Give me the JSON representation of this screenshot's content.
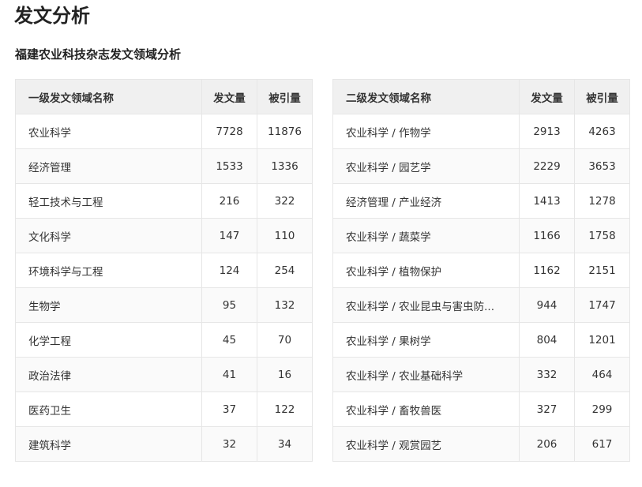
{
  "page_title": "发文分析",
  "section_title": "福建农业科技杂志发文领域分析",
  "primary_table": {
    "headers": {
      "name": "一级发文领域名称",
      "papers": "发文量",
      "citations": "被引量"
    },
    "rows": [
      {
        "name": "农业科学",
        "papers": "7728",
        "citations": "11876"
      },
      {
        "name": "经济管理",
        "papers": "1533",
        "citations": "1336"
      },
      {
        "name": "轻工技术与工程",
        "papers": "216",
        "citations": "322"
      },
      {
        "name": "文化科学",
        "papers": "147",
        "citations": "110"
      },
      {
        "name": "环境科学与工程",
        "papers": "124",
        "citations": "254"
      },
      {
        "name": "生物学",
        "papers": "95",
        "citations": "132"
      },
      {
        "name": "化学工程",
        "papers": "45",
        "citations": "70"
      },
      {
        "name": "政治法律",
        "papers": "41",
        "citations": "16"
      },
      {
        "name": "医药卫生",
        "papers": "37",
        "citations": "122"
      },
      {
        "name": "建筑科学",
        "papers": "32",
        "citations": "34"
      }
    ]
  },
  "secondary_table": {
    "headers": {
      "name": "二级发文领域名称",
      "papers": "发文量",
      "citations": "被引量"
    },
    "rows": [
      {
        "name": "农业科学 / 作物学",
        "papers": "2913",
        "citations": "4263"
      },
      {
        "name": "农业科学 / 园艺学",
        "papers": "2229",
        "citations": "3653"
      },
      {
        "name": "经济管理 / 产业经济",
        "papers": "1413",
        "citations": "1278"
      },
      {
        "name": "农业科学 / 蔬菜学",
        "papers": "1166",
        "citations": "1758"
      },
      {
        "name": "农业科学 / 植物保护",
        "papers": "1162",
        "citations": "2151"
      },
      {
        "name": "农业科学 / 农业昆虫与害虫防...",
        "papers": "944",
        "citations": "1747"
      },
      {
        "name": "农业科学 / 果树学",
        "papers": "804",
        "citations": "1201"
      },
      {
        "name": "农业科学 / 农业基础科学",
        "papers": "332",
        "citations": "464"
      },
      {
        "name": "农业科学 / 畜牧兽医",
        "papers": "327",
        "citations": "299"
      },
      {
        "name": "农业科学 / 观赏园艺",
        "papers": "206",
        "citations": "617"
      }
    ]
  }
}
